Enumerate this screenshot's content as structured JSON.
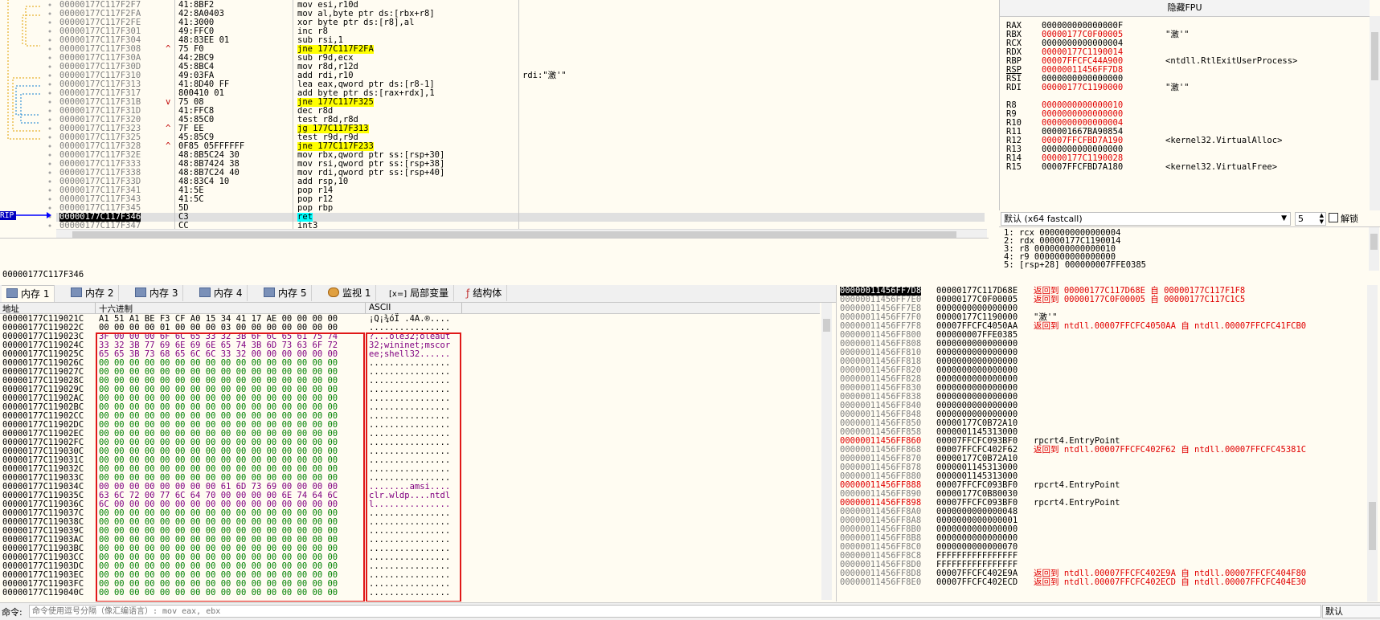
{
  "disasm": {
    "rows": [
      {
        "addr": "00000177C117F2F7",
        "bytes": "41:8BF2",
        "arrow": "",
        "instr": "mov esi,r10d",
        "comment": "",
        "hl": ""
      },
      {
        "addr": "00000177C117F2FA",
        "bytes": "42:8A0403",
        "arrow": "",
        "instr": "mov al,byte ptr ds:[rbx+r8]",
        "comment": "",
        "hl": ""
      },
      {
        "addr": "00000177C117F2FE",
        "bytes": "41:3000",
        "arrow": "",
        "instr": "xor byte ptr ds:[r8],al",
        "comment": "",
        "hl": ""
      },
      {
        "addr": "00000177C117F301",
        "bytes": "49:FFC0",
        "arrow": "",
        "instr": "inc r8",
        "comment": "",
        "hl": ""
      },
      {
        "addr": "00000177C117F304",
        "bytes": "48:83EE 01",
        "arrow": "",
        "instr": "sub rsi,1",
        "comment": "",
        "hl": ""
      },
      {
        "addr": "00000177C117F308",
        "bytes": "75 F0",
        "arrow": "^",
        "instr": "jne 177C117F2FA",
        "comment": "",
        "hl": "yellow"
      },
      {
        "addr": "00000177C117F30A",
        "bytes": "44:2BC9",
        "arrow": "",
        "instr": "sub r9d,ecx",
        "comment": "",
        "hl": ""
      },
      {
        "addr": "00000177C117F30D",
        "bytes": "45:8BC4",
        "arrow": "",
        "instr": "mov r8d,r12d",
        "comment": "",
        "hl": ""
      },
      {
        "addr": "00000177C117F310",
        "bytes": "49:03FA",
        "arrow": "",
        "instr": "add rdi,r10",
        "comment": "rdi:\"激'\"",
        "hl": ""
      },
      {
        "addr": "00000177C117F313",
        "bytes": "41:8D40 FF",
        "arrow": "",
        "instr": "lea eax,qword ptr ds:[r8-1]",
        "comment": "",
        "hl": ""
      },
      {
        "addr": "00000177C117F317",
        "bytes": "800410 01",
        "arrow": "",
        "instr": "add byte ptr ds:[rax+rdx],1",
        "comment": "",
        "hl": ""
      },
      {
        "addr": "00000177C117F31B",
        "bytes": "75 08",
        "arrow": "v",
        "instr": "jne 177C117F325",
        "comment": "",
        "hl": "yellow"
      },
      {
        "addr": "00000177C117F31D",
        "bytes": "41:FFC8",
        "arrow": "",
        "instr": "dec r8d",
        "comment": "",
        "hl": ""
      },
      {
        "addr": "00000177C117F320",
        "bytes": "45:85C0",
        "arrow": "",
        "instr": "test r8d,r8d",
        "comment": "",
        "hl": ""
      },
      {
        "addr": "00000177C117F323",
        "bytes": "7F EE",
        "arrow": "^",
        "instr": "jg 177C117F313",
        "comment": "",
        "hl": "yellow"
      },
      {
        "addr": "00000177C117F325",
        "bytes": "45:85C9",
        "arrow": "",
        "instr": "test r9d,r9d",
        "comment": "",
        "hl": ""
      },
      {
        "addr": "00000177C117F328",
        "bytes": "0F85 05FFFFFF",
        "arrow": "^",
        "instr": "jne 177C117F233",
        "comment": "",
        "hl": "yellow"
      },
      {
        "addr": "00000177C117F32E",
        "bytes": "48:8B5C24 30",
        "arrow": "",
        "instr": "mov rbx,qword ptr ss:[rsp+30]",
        "comment": "",
        "hl": ""
      },
      {
        "addr": "00000177C117F333",
        "bytes": "48:8B7424 38",
        "arrow": "",
        "instr": "mov rsi,qword ptr ss:[rsp+38]",
        "comment": "",
        "hl": ""
      },
      {
        "addr": "00000177C117F338",
        "bytes": "48:8B7C24 40",
        "arrow": "",
        "instr": "mov rdi,qword ptr ss:[rsp+40]",
        "comment": "",
        "hl": ""
      },
      {
        "addr": "00000177C117F33D",
        "bytes": "48:83C4 10",
        "arrow": "",
        "instr": "add rsp,10",
        "comment": "",
        "hl": ""
      },
      {
        "addr": "00000177C117F341",
        "bytes": "41:5E",
        "arrow": "",
        "instr": "pop r14",
        "comment": "",
        "hl": ""
      },
      {
        "addr": "00000177C117F343",
        "bytes": "41:5C",
        "arrow": "",
        "instr": "pop r12",
        "comment": "",
        "hl": ""
      },
      {
        "addr": "00000177C117F345",
        "bytes": "5D",
        "arrow": "",
        "instr": "pop rbp",
        "comment": "",
        "hl": ""
      },
      {
        "addr": "00000177C117F346",
        "bytes": "C3",
        "arrow": "",
        "instr": "ret",
        "comment": "",
        "hl": "cyan"
      },
      {
        "addr": "00000177C117F347",
        "bytes": "CC",
        "arrow": "",
        "instr": "int3",
        "comment": "",
        "hl": ""
      }
    ],
    "rip_label": "RIP",
    "current_address": "00000177C117F346"
  },
  "registers": {
    "header": "隐藏FPU",
    "rows": [
      {
        "name": "RAX",
        "value": "000000000000000F",
        "comment": ""
      },
      {
        "name": "RBX",
        "value": "00000177C0F00005",
        "comment": "\"激'\""
      },
      {
        "name": "RCX",
        "value": "0000000000000004",
        "comment": ""
      },
      {
        "name": "RDX",
        "value": "00000177C1190014",
        "comment": ""
      },
      {
        "name": "RBP",
        "value": "00007FFCFC44A900",
        "comment": "<ntdll.RtlExitUserProcess>"
      },
      {
        "name": "RSP",
        "value": "00000011456FF7D8",
        "comment": ""
      },
      {
        "name": "RSI",
        "value": "0000000000000000",
        "comment": ""
      },
      {
        "name": "RDI",
        "value": "00000177C1190000",
        "comment": "\"激'\""
      },
      {
        "name": "",
        "value": "",
        "comment": ""
      },
      {
        "name": "R8",
        "value": "0000000000000010",
        "comment": ""
      },
      {
        "name": "R9",
        "value": "0000000000000000",
        "comment": ""
      },
      {
        "name": "R10",
        "value": "0000000000000004",
        "comment": ""
      },
      {
        "name": "R11",
        "value": "000001667BA90854",
        "comment": ""
      },
      {
        "name": "R12",
        "value": "00007FFCFBD7A190",
        "comment": "<kernel32.VirtualAlloc>"
      },
      {
        "name": "R13",
        "value": "0000000000000000",
        "comment": ""
      },
      {
        "name": "R14",
        "value": "00000177C1190028",
        "comment": ""
      },
      {
        "name": "R15",
        "value": "00007FFCFBD7A180",
        "comment": "<kernel32.VirtualFree>"
      }
    ],
    "callconv": "默认 (x64 fastcall)",
    "arg_count": "5",
    "unlock_label": "解锁",
    "args": [
      "1: rcx 0000000000000004",
      "2: rdx 00000177C1190014",
      "3: r8 0000000000000010",
      "4: r9 0000000000000000",
      "5: [rsp+28] 000000007FFE0385"
    ]
  },
  "tabs": [
    {
      "label": "内存 1"
    },
    {
      "label": "内存 2"
    },
    {
      "label": "内存 3"
    },
    {
      "label": "内存 4"
    },
    {
      "label": "内存 5"
    },
    {
      "label": "监视 1"
    },
    {
      "label": "局部变量"
    },
    {
      "label": "结构体"
    }
  ],
  "dump": {
    "col_addr": "地址",
    "col_hex": "十六进制",
    "col_ascii": "ASCII",
    "rows": [
      {
        "addr": "00000177C119021C",
        "hex": "A1 51 A1 BE F3 CF A0 15 34 41 17 AE 00 00 00 00",
        "ascii": "¡Q¡¾óÏ .4A.®...."
      },
      {
        "addr": "00000177C119022C",
        "hex": "00 00 00 00 01 00 00 00 03 00 00 00 00 00 00 00",
        "ascii": "................"
      },
      {
        "addr": "00000177C119023C",
        "hex": "3F 00 00 00 6F 6C 65 33 32 3B 6F 6C 65 61 75 74",
        "ascii": "?...ole32;oleaut"
      },
      {
        "addr": "00000177C119024C",
        "hex": "33 32 3B 77 69 6E 69 6E 65 74 3B 6D 73 63 6F 72",
        "ascii": "32;wininet;mscor"
      },
      {
        "addr": "00000177C119025C",
        "hex": "65 65 3B 73 68 65 6C 6C 33 32 00 00 00 00 00 00",
        "ascii": "ee;shell32......"
      },
      {
        "addr": "00000177C119026C",
        "hex": "00 00 00 00 00 00 00 00 00 00 00 00 00 00 00 00",
        "ascii": "................"
      },
      {
        "addr": "00000177C119027C",
        "hex": "00 00 00 00 00 00 00 00 00 00 00 00 00 00 00 00",
        "ascii": "................"
      },
      {
        "addr": "00000177C119028C",
        "hex": "00 00 00 00 00 00 00 00 00 00 00 00 00 00 00 00",
        "ascii": "................"
      },
      {
        "addr": "00000177C119029C",
        "hex": "00 00 00 00 00 00 00 00 00 00 00 00 00 00 00 00",
        "ascii": "................"
      },
      {
        "addr": "00000177C11902AC",
        "hex": "00 00 00 00 00 00 00 00 00 00 00 00 00 00 00 00",
        "ascii": "................"
      },
      {
        "addr": "00000177C11902BC",
        "hex": "00 00 00 00 00 00 00 00 00 00 00 00 00 00 00 00",
        "ascii": "................"
      },
      {
        "addr": "00000177C11902CC",
        "hex": "00 00 00 00 00 00 00 00 00 00 00 00 00 00 00 00",
        "ascii": "................"
      },
      {
        "addr": "00000177C11902DC",
        "hex": "00 00 00 00 00 00 00 00 00 00 00 00 00 00 00 00",
        "ascii": "................"
      },
      {
        "addr": "00000177C11902EC",
        "hex": "00 00 00 00 00 00 00 00 00 00 00 00 00 00 00 00",
        "ascii": "................"
      },
      {
        "addr": "00000177C11902FC",
        "hex": "00 00 00 00 00 00 00 00 00 00 00 00 00 00 00 00",
        "ascii": "................"
      },
      {
        "addr": "00000177C119030C",
        "hex": "00 00 00 00 00 00 00 00 00 00 00 00 00 00 00 00",
        "ascii": "................"
      },
      {
        "addr": "00000177C119031C",
        "hex": "00 00 00 00 00 00 00 00 00 00 00 00 00 00 00 00",
        "ascii": "................"
      },
      {
        "addr": "00000177C119032C",
        "hex": "00 00 00 00 00 00 00 00 00 00 00 00 00 00 00 00",
        "ascii": "................"
      },
      {
        "addr": "00000177C119033C",
        "hex": "00 00 00 00 00 00 00 00 00 00 00 00 00 00 00 00",
        "ascii": "................"
      },
      {
        "addr": "00000177C119034C",
        "hex": "00 00 00 00 00 00 00 00 61 6D 73 69 00 00 00 00",
        "ascii": "........amsi...."
      },
      {
        "addr": "00000177C119035C",
        "hex": "63 6C 72 00 77 6C 64 70 00 00 00 00 6E 74 64 6C",
        "ascii": "clr.wldp....ntdl"
      },
      {
        "addr": "00000177C119036C",
        "hex": "6C 00 00 00 00 00 00 00 00 00 00 00 00 00 00 00",
        "ascii": "l..............."
      },
      {
        "addr": "00000177C119037C",
        "hex": "00 00 00 00 00 00 00 00 00 00 00 00 00 00 00 00",
        "ascii": "................"
      },
      {
        "addr": "00000177C119038C",
        "hex": "00 00 00 00 00 00 00 00 00 00 00 00 00 00 00 00",
        "ascii": "................"
      },
      {
        "addr": "00000177C119039C",
        "hex": "00 00 00 00 00 00 00 00 00 00 00 00 00 00 00 00",
        "ascii": "................"
      },
      {
        "addr": "00000177C11903AC",
        "hex": "00 00 00 00 00 00 00 00 00 00 00 00 00 00 00 00",
        "ascii": "................"
      },
      {
        "addr": "00000177C11903BC",
        "hex": "00 00 00 00 00 00 00 00 00 00 00 00 00 00 00 00",
        "ascii": "................"
      },
      {
        "addr": "00000177C11903CC",
        "hex": "00 00 00 00 00 00 00 00 00 00 00 00 00 00 00 00",
        "ascii": "................"
      },
      {
        "addr": "00000177C11903DC",
        "hex": "00 00 00 00 00 00 00 00 00 00 00 00 00 00 00 00",
        "ascii": "................"
      },
      {
        "addr": "00000177C11903EC",
        "hex": "00 00 00 00 00 00 00 00 00 00 00 00 00 00 00 00",
        "ascii": "................"
      },
      {
        "addr": "00000177C11903FC",
        "hex": "00 00 00 00 00 00 00 00 00 00 00 00 00 00 00 00",
        "ascii": "................"
      },
      {
        "addr": "00000177C119040C",
        "hex": "00 00 00 00 00 00 00 00 00 00 00 00 00 00 00 00",
        "ascii": "................"
      }
    ]
  },
  "stack": {
    "rows": [
      {
        "addr": "00000011456FF7D8",
        "value": "00000177C117D68E",
        "comment": "返回到 00000177C117D68E 自 00000177C117F1F8",
        "cc": "red"
      },
      {
        "addr": "00000011456FF7E0",
        "value": "00000177C0F00005",
        "comment": "返回到 00000177C0F00005 自 00000177C117C1C5",
        "cc": "red"
      },
      {
        "addr": "00000011456FF7E8",
        "value": "0000000000000000",
        "comment": "",
        "cc": ""
      },
      {
        "addr": "00000011456FF7F0",
        "value": "00000177C1190000",
        "comment": "\"激'\"",
        "cc": ""
      },
      {
        "addr": "00000011456FF7F8",
        "value": "00007FFCFC4050AA",
        "comment": "返回到 ntdll.00007FFCFC4050AA 自 ntdll.00007FFCFC41FCB0",
        "cc": "red"
      },
      {
        "addr": "00000011456FF800",
        "value": "000000007FFE0385",
        "comment": "",
        "cc": ""
      },
      {
        "addr": "00000011456FF808",
        "value": "0000000000000000",
        "comment": "",
        "cc": ""
      },
      {
        "addr": "00000011456FF810",
        "value": "0000000000000000",
        "comment": "",
        "cc": ""
      },
      {
        "addr": "00000011456FF818",
        "value": "0000000000000000",
        "comment": "",
        "cc": ""
      },
      {
        "addr": "00000011456FF820",
        "value": "0000000000000000",
        "comment": "",
        "cc": ""
      },
      {
        "addr": "00000011456FF828",
        "value": "0000000000000000",
        "comment": "",
        "cc": ""
      },
      {
        "addr": "00000011456FF830",
        "value": "0000000000000000",
        "comment": "",
        "cc": ""
      },
      {
        "addr": "00000011456FF838",
        "value": "0000000000000000",
        "comment": "",
        "cc": ""
      },
      {
        "addr": "00000011456FF840",
        "value": "0000000000000000",
        "comment": "",
        "cc": ""
      },
      {
        "addr": "00000011456FF848",
        "value": "0000000000000000",
        "comment": "",
        "cc": ""
      },
      {
        "addr": "00000011456FF850",
        "value": "00000177C0B72A10",
        "comment": "",
        "cc": ""
      },
      {
        "addr": "00000011456FF858",
        "value": "0000001145313000",
        "comment": "",
        "cc": ""
      },
      {
        "addr": "00000011456FF860",
        "value": "00007FFCFC093BF0",
        "comment": "rpcrt4.EntryPoint",
        "cc": "",
        "ared": true
      },
      {
        "addr": "00000011456FF868",
        "value": "00007FFCFC402F62",
        "comment": "返回到 ntdll.00007FFCFC402F62 自 ntdll.00007FFCFC45381C",
        "cc": "red"
      },
      {
        "addr": "00000011456FF870",
        "value": "00000177C0B72A10",
        "comment": "",
        "cc": ""
      },
      {
        "addr": "00000011456FF878",
        "value": "0000001145313000",
        "comment": "",
        "cc": ""
      },
      {
        "addr": "00000011456FF880",
        "value": "0000001145313000",
        "comment": "",
        "cc": ""
      },
      {
        "addr": "00000011456FF888",
        "value": "00007FFCFC093BF0",
        "comment": "rpcrt4.EntryPoint",
        "cc": "",
        "ared": true
      },
      {
        "addr": "00000011456FF890",
        "value": "00000177C0B80030",
        "comment": "",
        "cc": ""
      },
      {
        "addr": "00000011456FF898",
        "value": "00007FFCFC093BF0",
        "comment": "rpcrt4.EntryPoint",
        "cc": "",
        "ared": true
      },
      {
        "addr": "00000011456FF8A0",
        "value": "0000000000000048",
        "comment": "",
        "cc": ""
      },
      {
        "addr": "00000011456FF8A8",
        "value": "0000000000000001",
        "comment": "",
        "cc": ""
      },
      {
        "addr": "00000011456FF8B0",
        "value": "0000000000000000",
        "comment": "",
        "cc": ""
      },
      {
        "addr": "00000011456FF8B8",
        "value": "0000000000000000",
        "comment": "",
        "cc": ""
      },
      {
        "addr": "00000011456FF8C0",
        "value": "0000000000000070",
        "comment": "",
        "cc": ""
      },
      {
        "addr": "00000011456FF8C8",
        "value": "FFFFFFFFFFFFFFFF",
        "comment": "",
        "cc": ""
      },
      {
        "addr": "00000011456FF8D0",
        "value": "FFFFFFFFFFFFFFFF",
        "comment": "",
        "cc": ""
      },
      {
        "addr": "00000011456FF8D8",
        "value": "00007FFCFC402E9A",
        "comment": "返回到 ntdll.00007FFCFC402E9A 自 ntdll.00007FFCFC404F80",
        "cc": "red"
      },
      {
        "addr": "00000011456FF8E0",
        "value": "00007FFCFC402ECD",
        "comment": "返回到 ntdll.00007FFCFC402ECD 自 ntdll.00007FFCFC404E30",
        "cc": "red"
      }
    ]
  },
  "command": {
    "label": "命令:",
    "placeholder": "命令使用逗号分隔（像汇编语言）: mov eax, ebx",
    "mode": "默认"
  },
  "colors": {
    "background": "#fffcf2",
    "jump_highlight": "#ffff00",
    "ret_highlight": "#00ffff",
    "hex_text": "#008000",
    "return_comment": "#e00000",
    "box_outline": "#e01818"
  }
}
